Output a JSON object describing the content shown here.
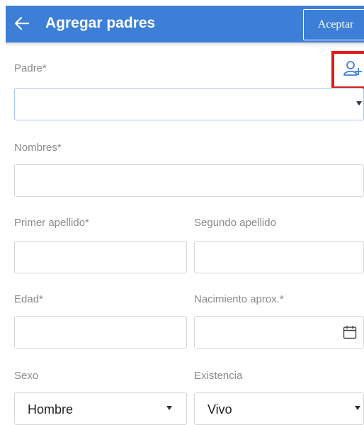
{
  "header": {
    "title": "Agregar padres",
    "accept_label": "Aceptar",
    "back_icon": "arrow-left-icon",
    "background_color": "#3d7fd6"
  },
  "form": {
    "padre": {
      "label": "Padre*",
      "value": "",
      "add_icon": "add-person-icon"
    },
    "nombres": {
      "label": "Nombres*",
      "value": ""
    },
    "primer_apellido": {
      "label": "Primer apellido*",
      "value": ""
    },
    "segundo_apellido": {
      "label": "Segundo apellido",
      "value": ""
    },
    "edad": {
      "label": "Edad*",
      "value": ""
    },
    "nacimiento": {
      "label": "Nacimiento aprox.*",
      "value": "",
      "icon": "calendar-icon"
    },
    "sexo": {
      "label": "Sexo",
      "value": "Hombre"
    },
    "existencia": {
      "label": "Existencia",
      "value": "Vivo"
    }
  },
  "highlight_color": "#e01a1a"
}
